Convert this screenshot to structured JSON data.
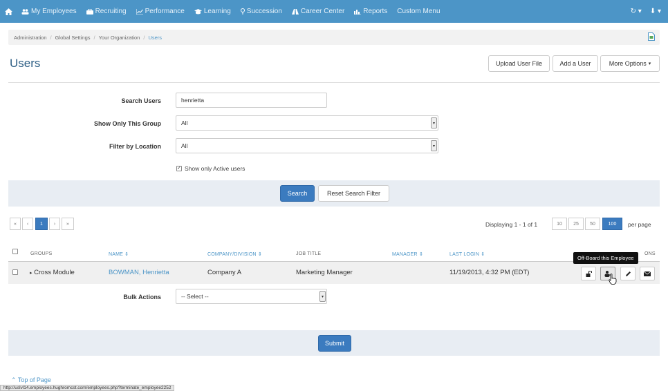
{
  "nav": {
    "items": [
      {
        "icon": "people-icon",
        "label": "My Employees"
      },
      {
        "icon": "briefcase-icon",
        "label": "Recruiting"
      },
      {
        "icon": "trend-chart-icon",
        "label": "Performance"
      },
      {
        "icon": "graduation-cap-icon",
        "label": "Learning"
      },
      {
        "icon": "map-pin-icon",
        "label": "Succession"
      },
      {
        "icon": "road-icon",
        "label": "Career Center"
      },
      {
        "icon": "bar-chart-icon",
        "label": "Reports"
      },
      {
        "icon": "",
        "label": "Custom Menu"
      }
    ],
    "accent": "#4c95c7"
  },
  "breadcrumb": {
    "items": [
      "Administration",
      "Global Settings",
      "Your Organization"
    ],
    "current": "Users"
  },
  "page": {
    "title": "Users",
    "upload_label": "Upload User File",
    "add_label": "Add a User",
    "more_label": "More Options"
  },
  "search": {
    "search_users_label": "Search Users",
    "search_users_value": "henrietta",
    "group_label": "Show Only This Group",
    "group_value": "All",
    "location_label": "Filter by Location",
    "location_value": "All",
    "active_only_label": "Show only Active users",
    "active_only_checked": true,
    "search_button": "Search",
    "reset_button": "Reset Search Filter"
  },
  "pager": {
    "first": "«",
    "prev": "‹",
    "page": "1",
    "next": "›",
    "last": "»",
    "displaying": "Displaying 1 - 1 of 1",
    "sizes": [
      "10",
      "25",
      "50",
      "100"
    ],
    "active_size": "100",
    "per_page": "per page"
  },
  "table": {
    "headers": {
      "groups": "GROUPS",
      "name": "NAME ⇕",
      "company": "COMPANY/DIVISION ⇕",
      "job_title": "JOB TITLE",
      "manager": "MANAGER ⇕",
      "last_login": "LAST LOGIN ⇕",
      "actions": "ONS"
    },
    "rows": [
      {
        "group": "Cross Module",
        "name": "BOWMAN, Henrietta",
        "company": "Company A",
        "job_title": "Marketing Manager",
        "manager": "",
        "last_login": "11/19/2013, 4:32 PM (EDT)"
      }
    ],
    "tooltip": "Off-Board this Employee"
  },
  "bulk": {
    "label": "Bulk Actions",
    "value": "-- Select --",
    "submit": "Submit"
  },
  "footer": {
    "top_link": "⌃ Top of Page",
    "status_url": "http://uslvl14.employees.hughromcst.com/employees.php?terminate_employee2252"
  }
}
